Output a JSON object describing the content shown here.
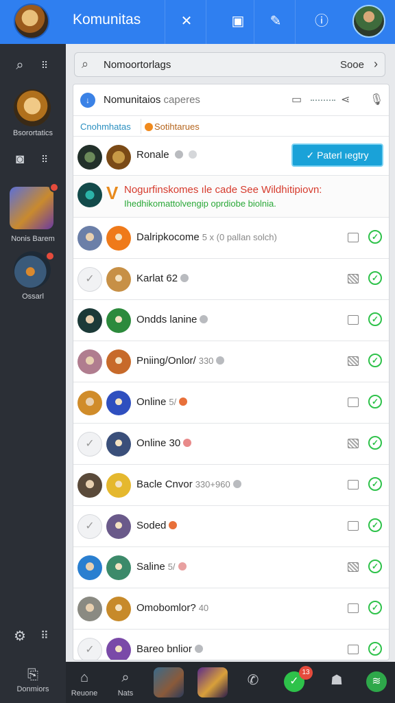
{
  "topbar": {
    "title": "Komunitas",
    "icons": [
      "close-icon",
      "bookmark-icon",
      "edit-icon",
      "info-icon"
    ],
    "icon_glyphs": [
      "✕",
      "▣",
      "✎",
      "ⓘ"
    ]
  },
  "sidebar": {
    "items": [
      {
        "label": "Bsorortatics"
      },
      {
        "label": "Nonis Barem"
      },
      {
        "label": "Ossarl"
      }
    ]
  },
  "search": {
    "value": "Nomoortorlags",
    "right_label": "Sooe"
  },
  "card": {
    "header_title": "Nomunitaios",
    "header_sub": "caperes",
    "tab1": "Cnohmhatas",
    "tab2": "Sotihtarues"
  },
  "first_row": {
    "name": "Ronale",
    "button_label": "Paterl ıegtry"
  },
  "notice": {
    "line1": "Nogurfinskomes ıle cade See Wildhitipiovn:",
    "line2": "Ihedhikomattolvengip oprdiobe biolnia."
  },
  "rows": [
    {
      "name": "Dalripkocome",
      "meta": "5 x (0 pallan solch)",
      "status_color": "",
      "box": "empty",
      "check_first": false,
      "av1": "#6b7fa8",
      "av2": "#ef7a1a"
    },
    {
      "name": "Karlat 62",
      "meta": "",
      "status_color": "#b9bbbf",
      "box": "pattern",
      "check_first": true,
      "av1": "",
      "av2": "#c79046"
    },
    {
      "name": "Ondds lanine",
      "meta": "",
      "status_color": "#b9bbbf",
      "box": "empty",
      "check_first": false,
      "av1": "#1c3a38",
      "av2": "#2c8a3c"
    },
    {
      "name": "Pniing/Onlor/",
      "meta": "330",
      "status_color": "#b9bbbf",
      "box": "pattern",
      "check_first": false,
      "av1": "#b07d8f",
      "av2": "#c76a2a"
    },
    {
      "name": "Online",
      "meta": "5/",
      "status_color": "#e8703a",
      "box": "empty",
      "check_first": false,
      "av1": "#d08c2a",
      "av2": "#2f4fbf"
    },
    {
      "name": "Online 30",
      "meta": "",
      "status_color": "#e88a8a",
      "box": "pattern",
      "check_first": true,
      "av1": "",
      "av2": "#3a4f7a"
    },
    {
      "name": "Bacle Cnvor",
      "meta": "330+960",
      "status_color": "#b9bbbf",
      "box": "empty",
      "check_first": false,
      "av1": "#5a4a3a",
      "av2": "#e5b82e"
    },
    {
      "name": "Soded",
      "meta": "",
      "status_color": "#e8703a",
      "box": "empty",
      "check_first": true,
      "av1": "",
      "av2": "#6a5a8a"
    },
    {
      "name": "Saline",
      "meta": "5/",
      "status_color": "#e8a0a0",
      "box": "pattern",
      "check_first": false,
      "av1": "#2a7fd0",
      "av2": "#3c8a6a"
    },
    {
      "name": "Omobomlor?",
      "meta": "40",
      "status_color": "",
      "box": "empty",
      "check_first": false,
      "av1": "#8a8a82",
      "av2": "#c78a2a"
    },
    {
      "name": "Bareo bnlior",
      "meta": "",
      "status_color": "#b9bbbf",
      "box": "empty",
      "check_first": true,
      "av1": "",
      "av2": "#7a4aa8"
    }
  ],
  "bottombar": {
    "left_label": "Donmiors",
    "items": [
      {
        "label": "Reuone"
      },
      {
        "label": "Nats"
      }
    ],
    "badge_count": "13"
  }
}
